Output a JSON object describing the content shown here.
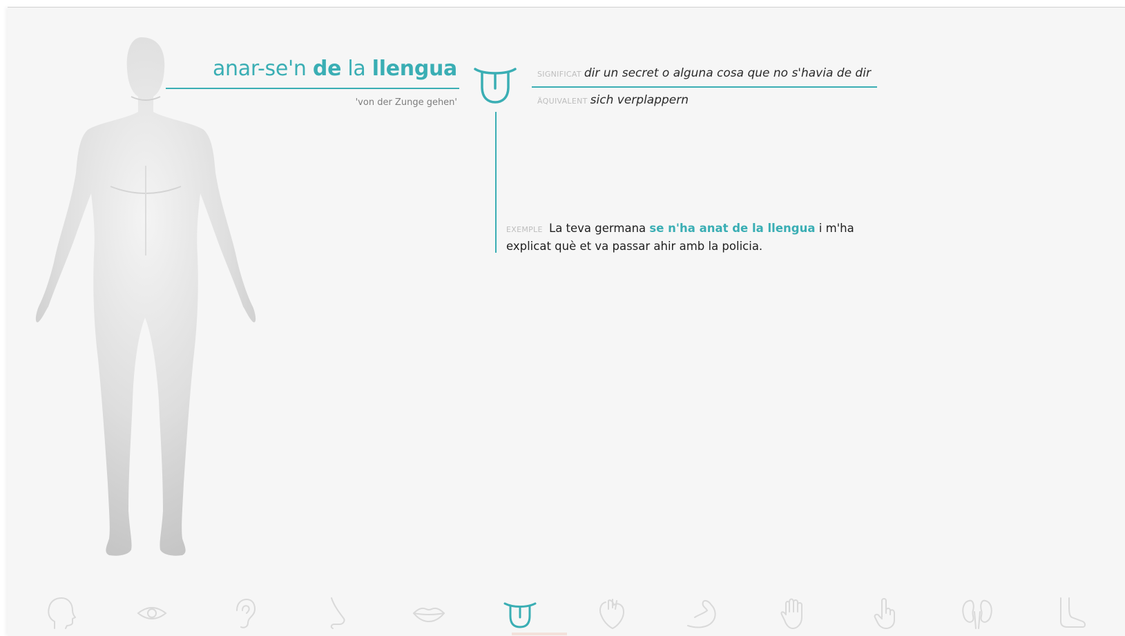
{
  "entry": {
    "title_parts": {
      "a": "anar-se'n",
      "b": "de",
      "c": "la",
      "d": "llengua"
    },
    "literal": "'von der Zunge gehen'",
    "meaning_label": "SIGNIFICAT",
    "meaning": "dir un secret o alguna cosa que no s'havia de dir",
    "equivalent_label": "ÄQUIVALENT",
    "equivalent": "sich verplappern",
    "example_label": "EXEMPLE",
    "example_before": "La teva germana",
    "example_highlight": "se n'ha anat de la llengua",
    "example_after": "i m'ha explicat què et va passar ahir amb la policia."
  },
  "nav": {
    "items": [
      "head-icon",
      "eye-icon",
      "ear-icon",
      "nose-icon",
      "lips-icon",
      "tongue-icon",
      "heart-icon",
      "arm-icon",
      "hand-icon",
      "finger-icon",
      "kidneys-icon",
      "foot-icon"
    ],
    "active": "tongue-icon"
  },
  "colors": {
    "accent": "#3aaeb4",
    "background": "#f6f6f6",
    "icon_inactive": "#d9d9d9",
    "label_gray": "#bdbdbd",
    "text": "#2a2a2a"
  }
}
